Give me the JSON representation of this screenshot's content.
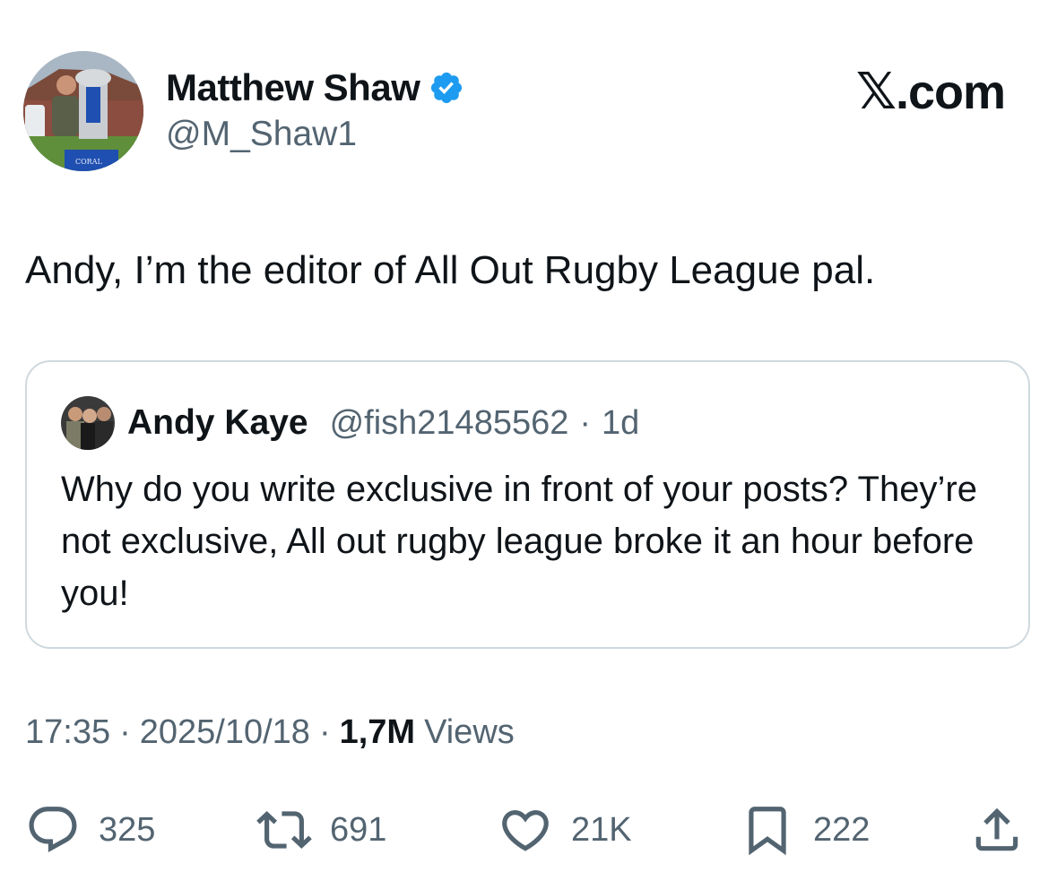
{
  "brand": {
    "text": ".com"
  },
  "author": {
    "name": "Matthew Shaw",
    "handle": "@M_Shaw1",
    "avatar_icon": "trophy-photo",
    "verified_icon": "verified-badge-icon",
    "verified_color": "#1d9bf0"
  },
  "tweet": {
    "text": "Andy, I’m the editor of All Out Rugby League pal."
  },
  "quote": {
    "name": "Andy Kaye",
    "handle": "@fish21485562",
    "separator": "·",
    "time": "1d",
    "text": "Why do you write exclusive in front of your posts? They’re not exclusive, All out rugby league broke it an hour before you!"
  },
  "meta": {
    "time": "17:35",
    "dot1": "·",
    "date": "2025/10/18",
    "dot2": "·",
    "views_count": "1,7M",
    "views_label": "Views"
  },
  "actions": {
    "replies": "325",
    "reposts": "691",
    "likes": "21K",
    "bookmarks": "222"
  },
  "colors": {
    "text": "#0f1419",
    "secondary": "#536471",
    "border": "#cfd9de",
    "accent": "#1d9bf0"
  }
}
